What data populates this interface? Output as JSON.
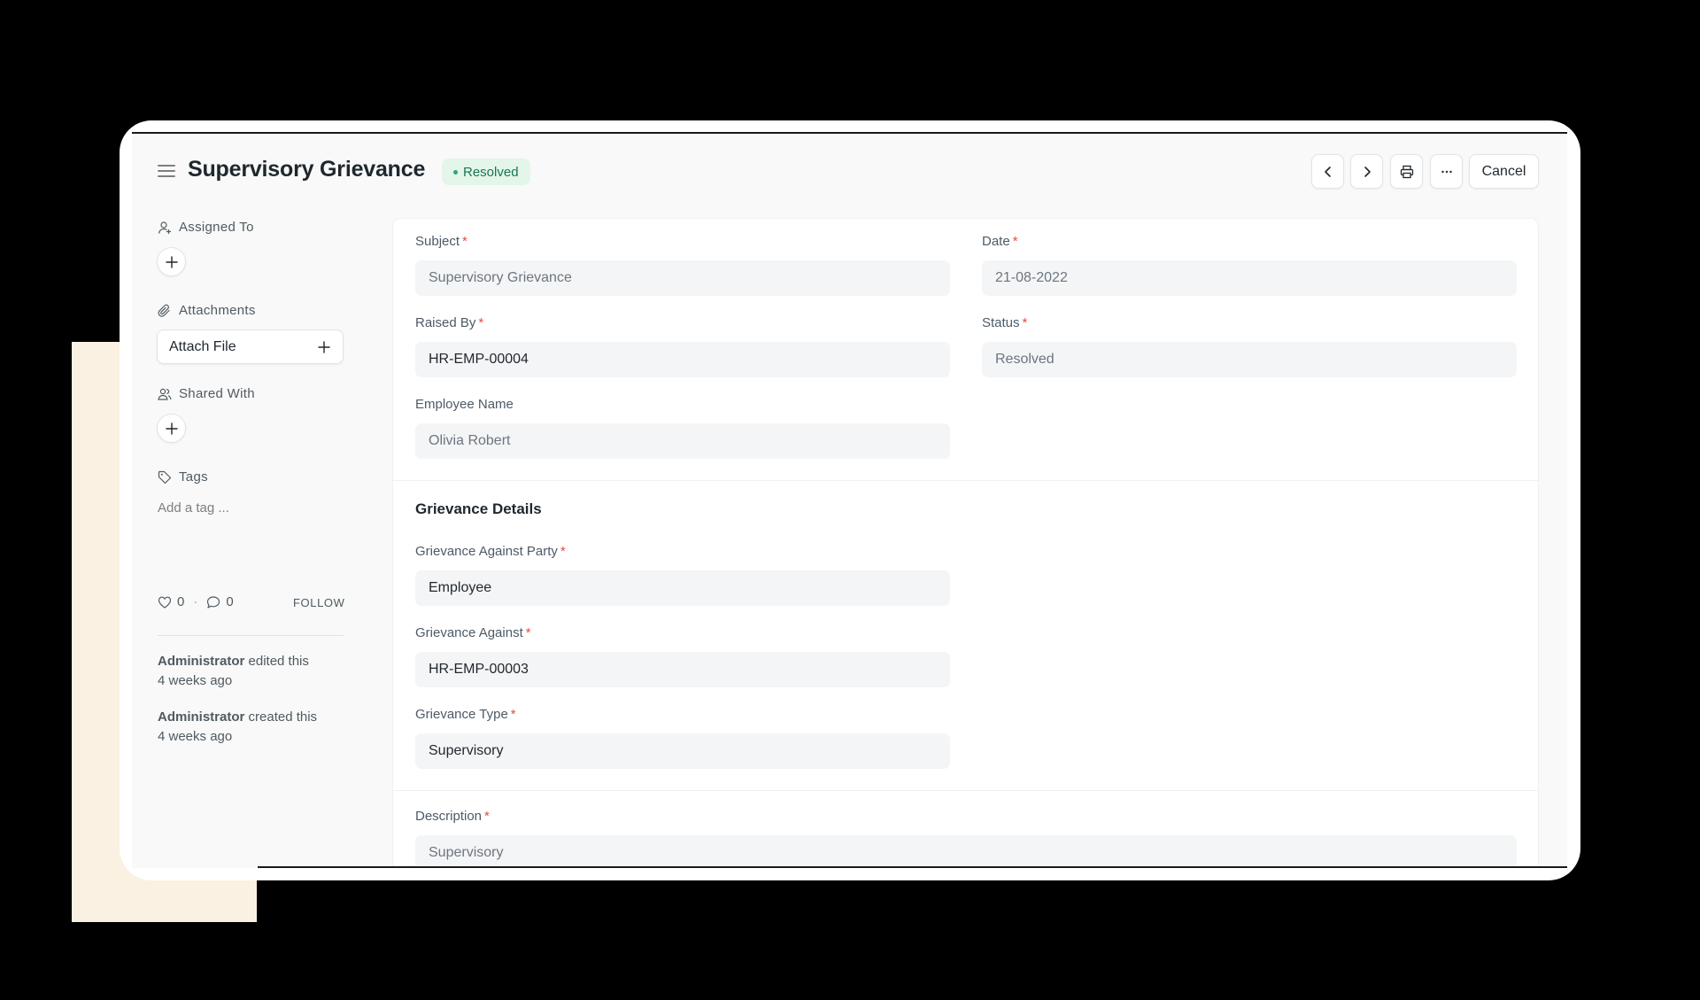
{
  "header": {
    "title": "Supervisory Grievance",
    "status": "Resolved",
    "cancel_label": "Cancel"
  },
  "sidebar": {
    "assigned_to_label": "Assigned To",
    "attachments_label": "Attachments",
    "attach_file_label": "Attach File",
    "shared_with_label": "Shared With",
    "tags_label": "Tags",
    "add_tag_label": "Add a tag ...",
    "likes": "0",
    "comments": "0",
    "separator": "·",
    "follow_label": "FOLLOW",
    "activity": [
      {
        "user": "Administrator",
        "action": " edited this",
        "time": "4 weeks ago"
      },
      {
        "user": "Administrator",
        "action": " created this",
        "time": "4 weeks ago"
      }
    ]
  },
  "form": {
    "subject": {
      "label": "Subject",
      "value": "Supervisory Grievance"
    },
    "date": {
      "label": "Date",
      "value": "21-08-2022"
    },
    "raised_by": {
      "label": "Raised By",
      "value": "HR-EMP-00004"
    },
    "status": {
      "label": "Status",
      "value": "Resolved"
    },
    "employee_name": {
      "label": "Employee Name",
      "value": "Olivia Robert"
    },
    "section_title": "Grievance Details",
    "grievance_against_party": {
      "label": "Grievance Against Party",
      "value": "Employee"
    },
    "grievance_against": {
      "label": "Grievance Against",
      "value": "HR-EMP-00003"
    },
    "grievance_type": {
      "label": "Grievance Type",
      "value": "Supervisory"
    },
    "description": {
      "label": "Description",
      "value": "Supervisory"
    },
    "required_mark": "*"
  },
  "colors": {
    "background": "#000000",
    "accent_cream": "#fbf1e2",
    "status_green": "#16794c",
    "status_bg": "#e4f5e9",
    "required_red": "#e24c4c"
  }
}
